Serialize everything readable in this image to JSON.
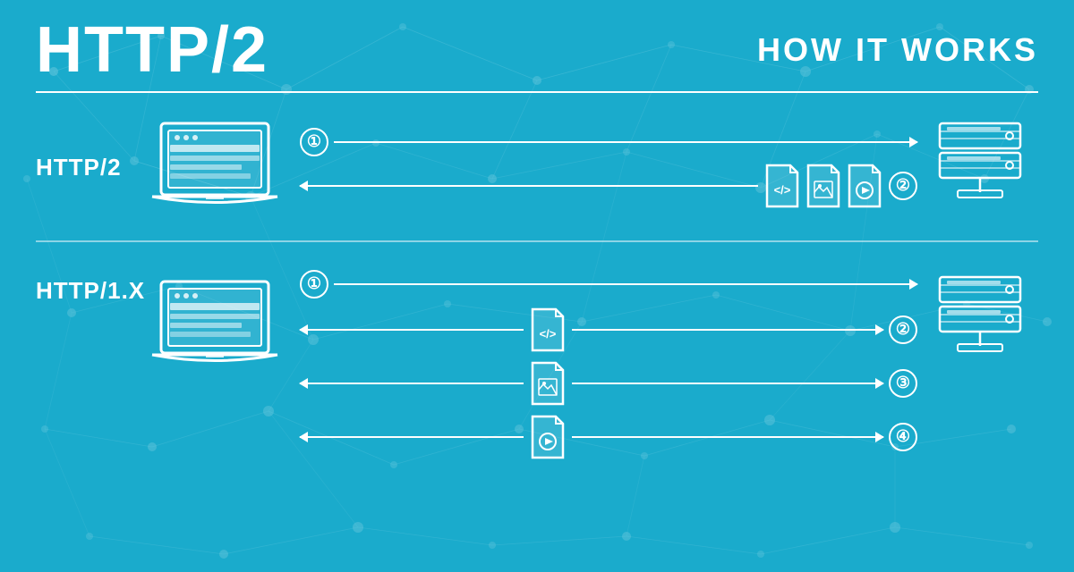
{
  "page": {
    "bg_color": "#1aabcc",
    "title": "HTTP/2",
    "subtitle": "HOW IT WORKS"
  },
  "sections": {
    "http2": {
      "label": "HTTP/2",
      "arrows": [
        {
          "dir": "right",
          "num": "1"
        },
        {
          "dir": "left",
          "files": [
            "code",
            "image",
            "video"
          ],
          "num": "2"
        }
      ]
    },
    "http1": {
      "label": "HTTP/1.X",
      "arrows": [
        {
          "dir": "right",
          "num": "1"
        },
        {
          "dir": "left",
          "file": "code",
          "num": "2"
        },
        {
          "dir": "left",
          "file": "image",
          "num": "3"
        },
        {
          "dir": "left",
          "file": "video",
          "num": "4"
        }
      ]
    }
  }
}
